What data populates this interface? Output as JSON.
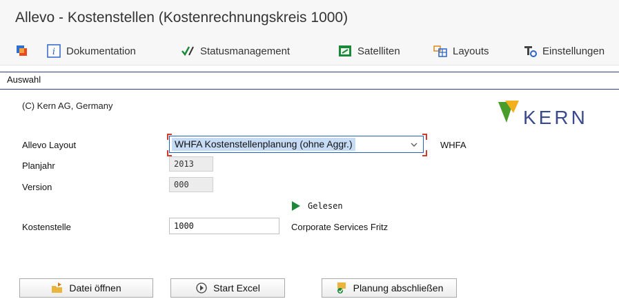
{
  "window": {
    "title": "Allevo - Kostenstellen (Kostenrechnungskreis 1000)"
  },
  "toolbar": {
    "items": [
      {
        "label": "",
        "icon": "multi-window-icon"
      },
      {
        "label": "Dokumentation",
        "icon": "info-icon"
      },
      {
        "label": "Statusmanagement",
        "icon": "checkmark-pen-icon"
      },
      {
        "label": "Satelliten",
        "icon": "satellite-window-icon"
      },
      {
        "label": "Layouts",
        "icon": "layout-grid-icon"
      },
      {
        "label": "Einstellungen",
        "icon": "settings-icon"
      }
    ]
  },
  "tab": {
    "label": "Auswahl"
  },
  "header": {
    "copyright": "(C) Kern AG, Germany",
    "logo_text": "KERN"
  },
  "form": {
    "layout": {
      "label": "Allevo Layout",
      "value": "WHFA Kostenstellenplanung (ohne Aggr.)",
      "code": "WHFA"
    },
    "planjahr": {
      "label": "Planjahr",
      "value": "2013"
    },
    "version": {
      "label": "Version",
      "value": "000"
    },
    "status": {
      "text": "Gelesen"
    },
    "kostenstelle": {
      "label": "Kostenstelle",
      "value": "1000",
      "description": "Corporate Services Fritz"
    }
  },
  "buttons": {
    "open_file": "Datei öffnen",
    "start_excel": "Start Excel",
    "close_planning": "Planung abschließen"
  },
  "colors": {
    "accent": "#1f5fbf",
    "status_green": "#1a8a3a",
    "logo_green": "#4a9d2a",
    "logo_text": "#3a4a8a"
  }
}
